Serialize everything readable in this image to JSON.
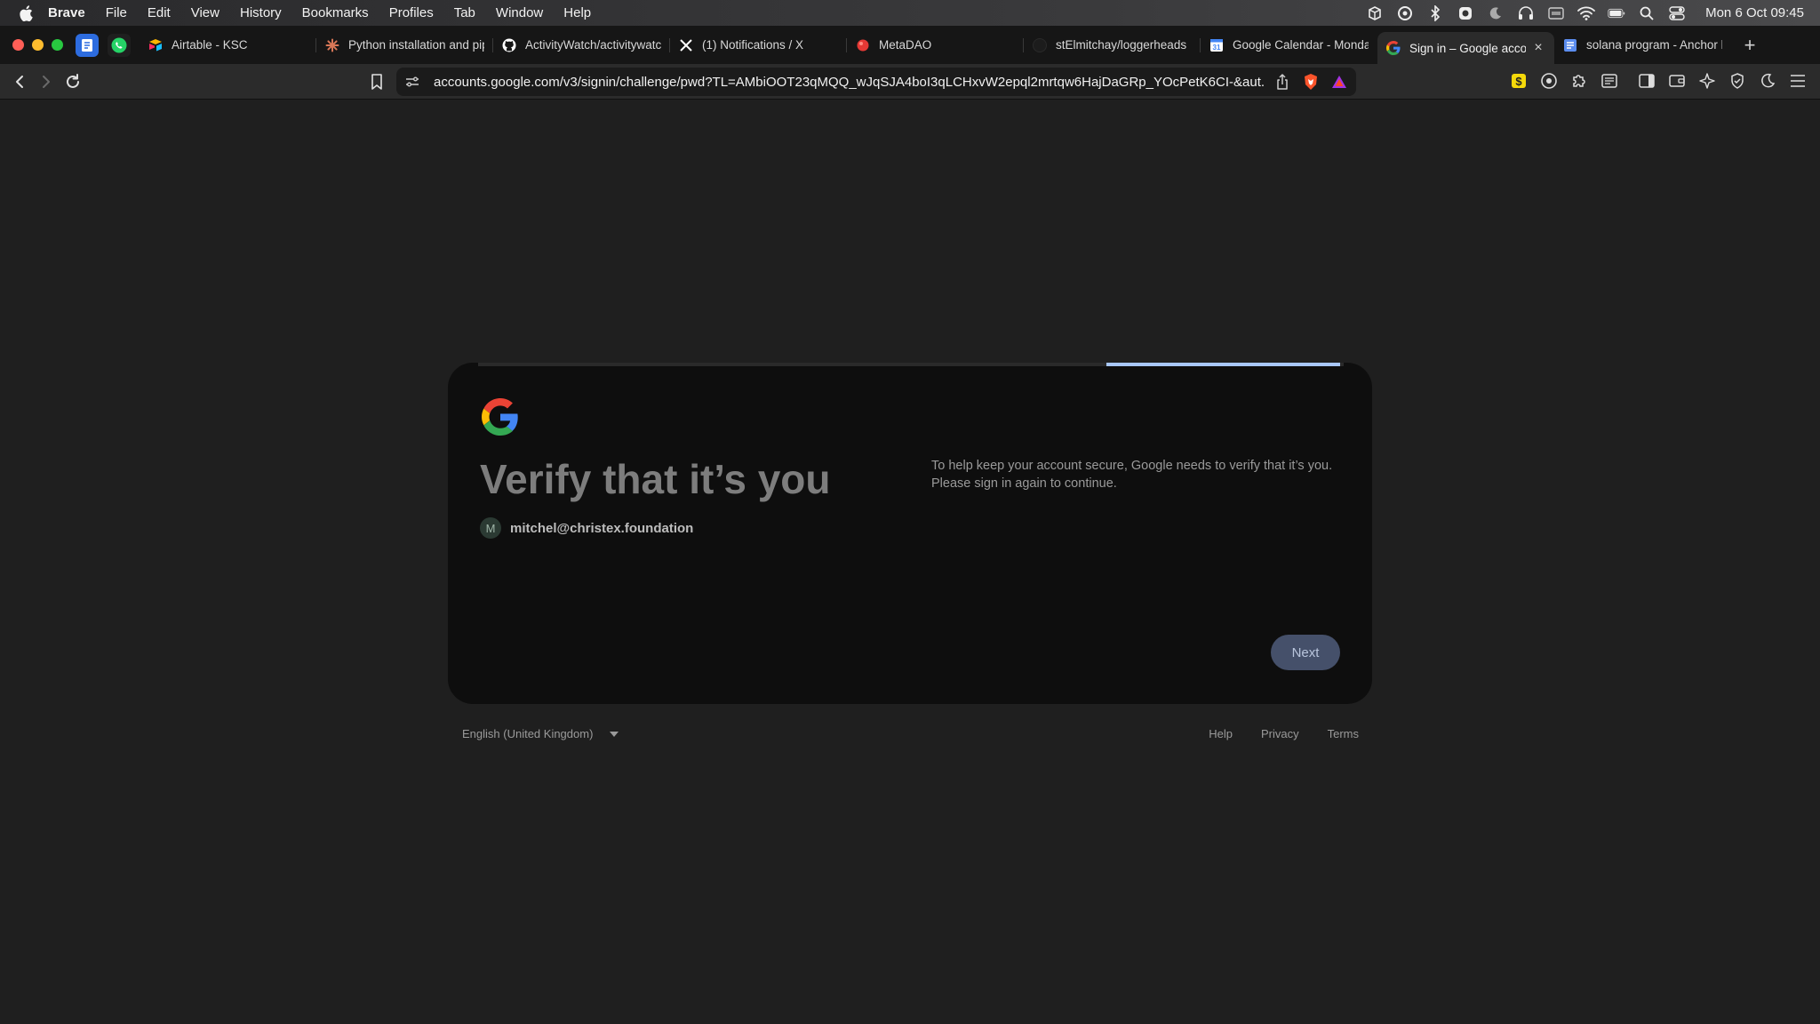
{
  "menubar": {
    "app": "Brave",
    "items": [
      "File",
      "Edit",
      "View",
      "History",
      "Bookmarks",
      "Profiles",
      "Tab",
      "Window",
      "Help"
    ],
    "clock": "Mon 6 Oct  09:45"
  },
  "tabs": [
    {
      "label": "Airtable - KSC",
      "favicon": "airtable-icon",
      "color": "#f8b400"
    },
    {
      "label": "Python installation and pip",
      "favicon": "claude-icon",
      "color": "#d97757"
    },
    {
      "label": "ActivityWatch/activitywatch",
      "favicon": "github-icon",
      "color": "#ffffff"
    },
    {
      "label": "(1) Notifications / X",
      "favicon": "x-icon",
      "color": "#ffffff"
    },
    {
      "label": "MetaDAO",
      "favicon": "metadao-icon",
      "color": "#e53935"
    },
    {
      "label": "stElmitchay/loggerheads",
      "favicon": "github-icon",
      "color": "#1c1c1c"
    },
    {
      "label": "Google Calendar - Monday",
      "favicon": "calendar-icon",
      "color": "#4285f4"
    },
    {
      "label": "Sign in – Google accounts",
      "favicon": "google-icon",
      "color": "#ffffff",
      "active": true
    },
    {
      "label": "solana program - Anchor b",
      "favicon": "stackexchange-icon",
      "color": "#5b8def"
    }
  ],
  "toolbar": {
    "url": "accounts.google.com/v3/signin/challenge/pwd?TL=AMbiOOT23qMQQ_wJqSJA4boI3qLCHxvW2epql2mrtqw6HajDaGRp_YOcPetK6CI-&aut..."
  },
  "signin": {
    "progress": 0.27,
    "title": "Verify that it’s you",
    "avatar_letter": "M",
    "email": "mitchel@christex.foundation",
    "description": "To help keep your account secure, Google needs to verify that it’s you. Please sign in again to continue.",
    "next_label": "Next"
  },
  "footer": {
    "language": "English (United Kingdom)",
    "links": [
      "Help",
      "Privacy",
      "Terms"
    ]
  },
  "colors": {
    "page_bg": "#1f1f1f",
    "card_bg": "#0e0e0e",
    "accent": "#a8c7fa",
    "next_bg": "#45506a"
  }
}
